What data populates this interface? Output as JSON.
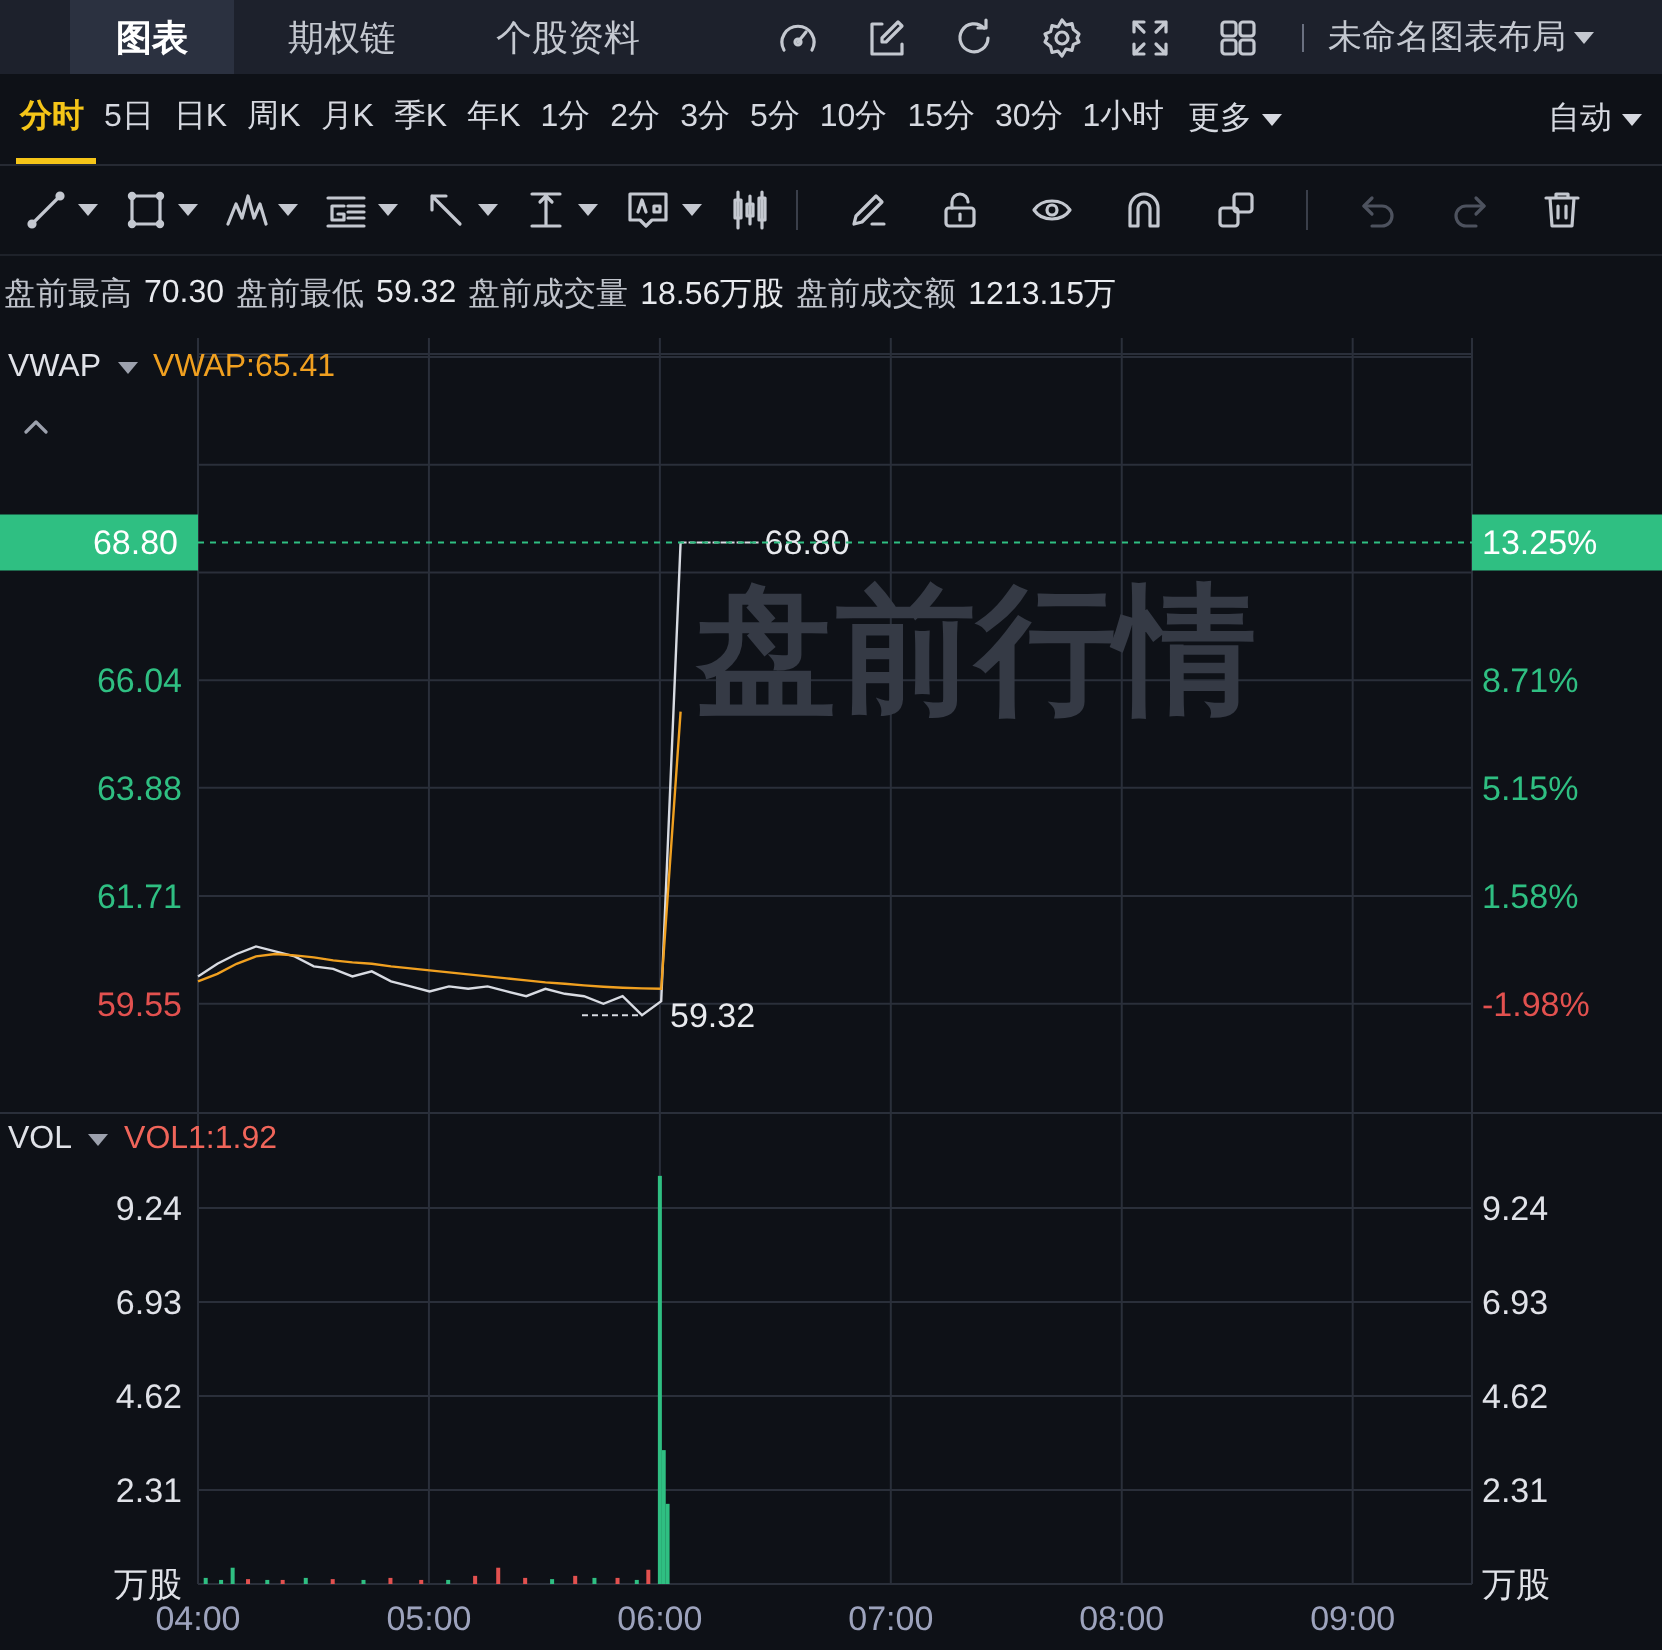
{
  "header": {
    "tabs": [
      {
        "label": "图表",
        "selected": true
      },
      {
        "label": "期权链",
        "selected": false
      },
      {
        "label": "个股资料",
        "selected": false
      }
    ],
    "layout_menu": "未命名图表布局"
  },
  "periods": {
    "items": [
      {
        "label": "分时",
        "selected": true
      },
      {
        "label": "5日",
        "selected": false
      },
      {
        "label": "日K",
        "selected": false
      },
      {
        "label": "周K",
        "selected": false
      },
      {
        "label": "月K",
        "selected": false
      },
      {
        "label": "季K",
        "selected": false
      },
      {
        "label": "年K",
        "selected": false
      },
      {
        "label": "1分",
        "selected": false
      },
      {
        "label": "2分",
        "selected": false
      },
      {
        "label": "3分",
        "selected": false
      },
      {
        "label": "5分",
        "selected": false
      },
      {
        "label": "10分",
        "selected": false
      },
      {
        "label": "15分",
        "selected": false
      },
      {
        "label": "30分",
        "selected": false
      },
      {
        "label": "1小时",
        "selected": false
      }
    ],
    "more": "更多",
    "scale_menu": "自动"
  },
  "toolbar": {
    "history_buttons": [
      {
        "disabled": true
      },
      {
        "disabled": true
      }
    ]
  },
  "stats": [
    {
      "label": "盘前最高",
      "value": "70.30"
    },
    {
      "label": "盘前最低",
      "value": "59.32"
    },
    {
      "label": "盘前成交量",
      "value": "18.56万股"
    },
    {
      "label": "盘前成交额",
      "value": "1213.15万"
    }
  ],
  "price_panel": {
    "indicator": "VWAP",
    "indicator_value": "VWAP:65.41",
    "watermark": "盘前行情",
    "last_price_tag": {
      "price": "68.80",
      "percent": "13.25%"
    },
    "right_axis": [
      {
        "label": "8.71%",
        "color": "#2fbf82"
      },
      {
        "label": "5.15%",
        "color": "#2fbf82"
      },
      {
        "label": "1.58%",
        "color": "#2fbf82"
      },
      {
        "label": "-1.98%",
        "color": "#e2514f"
      }
    ],
    "high_label": "68.80",
    "low_label": "59.32",
    "chart_data": {
      "type": "line",
      "grid": true,
      "ylim": [
        57.46,
        72.62
      ],
      "yticks": [
        {
          "value": 66.04,
          "label": "66.04"
        },
        {
          "value": 63.88,
          "label": "63.88"
        },
        {
          "value": 61.71,
          "label": "61.71"
        },
        {
          "value": 59.55,
          "label": "59.55"
        }
      ],
      "categories": [
        null,
        null,
        null,
        null,
        null,
        null,
        null,
        null,
        null,
        null,
        null,
        null,
        null,
        null,
        null,
        null,
        null,
        null,
        null,
        null,
        null,
        null,
        null,
        null,
        null,
        null,
        null,
        null,
        null,
        null,
        null,
        null,
        null,
        null,
        null,
        null,
        null,
        null,
        null,
        null,
        null,
        null,
        null,
        null,
        null,
        null,
        null,
        null,
        null,
        null,
        null,
        null,
        null,
        null,
        null,
        null,
        null,
        null,
        null,
        null,
        null,
        null,
        null,
        null,
        null,
        null,
        null
      ],
      "series": [
        {
          "color": "#d8dbe2",
          "values": [
            60.1,
            60.35,
            60.55,
            60.7,
            60.6,
            60.5,
            60.3,
            60.25,
            60.1,
            60.2,
            60.0,
            59.9,
            59.8,
            59.9,
            59.85,
            59.9,
            59.8,
            59.7,
            59.85,
            59.75,
            59.7,
            59.55,
            59.7,
            59.32,
            59.6,
            68.8,
            null,
            null,
            null,
            null,
            null,
            null,
            null,
            null,
            null,
            null,
            null,
            null,
            null,
            null,
            null,
            null,
            null,
            null,
            null,
            null,
            null,
            null,
            null,
            null,
            null,
            null,
            null,
            null,
            null,
            null,
            null,
            null,
            null,
            null,
            null,
            null,
            null,
            null,
            null,
            null,
            null
          ]
        },
        {
          "color": "#f0a020",
          "values": [
            60.0,
            60.15,
            60.35,
            60.5,
            60.55,
            60.52,
            60.48,
            60.42,
            60.38,
            60.35,
            60.3,
            60.26,
            60.22,
            60.18,
            60.14,
            60.1,
            60.06,
            60.02,
            59.98,
            59.95,
            59.92,
            59.89,
            59.87,
            59.86,
            59.85,
            65.41,
            null,
            null,
            null,
            null,
            null,
            null,
            null,
            null,
            null,
            null,
            null,
            null,
            null,
            null,
            null,
            null,
            null,
            null,
            null,
            null,
            null,
            null,
            null,
            null,
            null,
            null,
            null,
            null,
            null,
            null,
            null,
            null,
            null,
            null,
            null,
            null,
            null,
            null,
            null,
            null,
            null
          ]
        }
      ],
      "ref_lines": [
        {
          "axis": "y",
          "value": 68.8,
          "color": "#2fbf82"
        }
      ]
    }
  },
  "volume_panel": {
    "indicator": "VOL",
    "indicator_value": "VOL1:1.92",
    "right_axis": [
      "9.24",
      "6.93",
      "4.62",
      "2.31",
      "万股"
    ],
    "chart_data": {
      "type": "bar",
      "grid": true,
      "xlim": [
        240,
        571
      ],
      "ylim": [
        0,
        11.55
      ],
      "stacked": true,
      "xticks": [
        {
          "value": 240,
          "label": "04:00"
        },
        {
          "value": 300,
          "label": "05:00"
        },
        {
          "value": 360,
          "label": "06:00"
        },
        {
          "value": 420,
          "label": "07:00"
        },
        {
          "value": 480,
          "label": "08:00"
        },
        {
          "value": 540,
          "label": "09:00"
        }
      ],
      "yticks": [
        {
          "value": 9.24,
          "label": "9.24"
        },
        {
          "value": 6.93,
          "label": "6.93"
        },
        {
          "value": 4.62,
          "label": "4.62"
        },
        {
          "value": 2.31,
          "label": "2.31"
        },
        {
          "value": 0,
          "label": "万股"
        }
      ],
      "x": [
        242,
        246,
        249,
        253,
        258,
        262,
        268,
        275,
        283,
        290,
        298,
        305,
        312,
        318,
        325,
        332,
        338,
        343,
        349,
        354,
        357,
        360,
        361,
        362
      ],
      "series": [
        {
          "color": "#2fbf82",
          "values": [
            0.15,
            0.1,
            0.4,
            null,
            0.1,
            null,
            0.15,
            null,
            0.1,
            null,
            null,
            0.1,
            null,
            null,
            null,
            0.12,
            null,
            0.15,
            null,
            0.1,
            null,
            10.03,
            3.29,
            1.97
          ]
        },
        {
          "color": "#e2514f",
          "values": [
            null,
            null,
            null,
            0.12,
            null,
            0.1,
            null,
            0.12,
            null,
            0.15,
            0.1,
            null,
            0.2,
            0.4,
            0.15,
            null,
            0.2,
            null,
            0.15,
            null,
            0.35,
            null,
            null,
            null
          ]
        }
      ]
    }
  }
}
